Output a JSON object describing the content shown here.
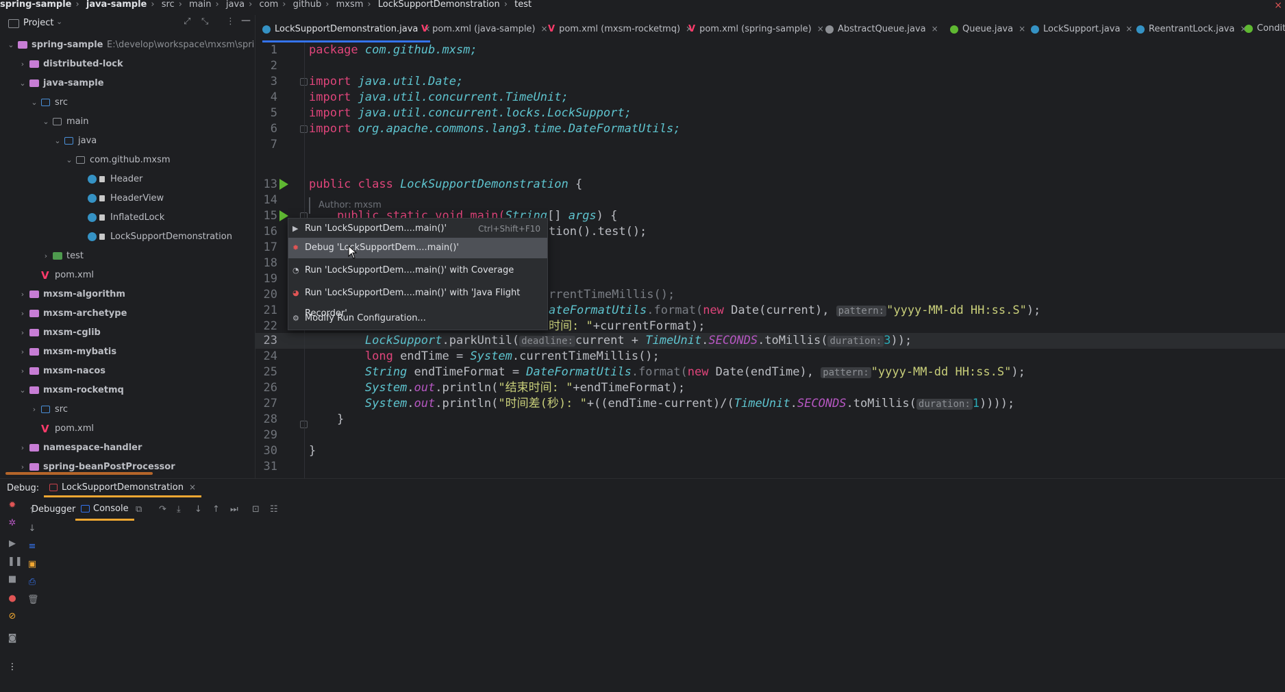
{
  "breadcrumb": [
    "spring-sample",
    "java-sample",
    "src",
    "main",
    "java",
    "com",
    "github",
    "mxsm",
    "LockSupportDemonstration",
    "test"
  ],
  "project": {
    "title": "Project",
    "tree": [
      {
        "label": "spring-sample",
        "extra": "E:\\develop\\workspace\\mxsm\\spring-sa",
        "level": 0,
        "kind": "module",
        "open": true
      },
      {
        "label": "distributed-lock",
        "level": 1,
        "kind": "module",
        "open": false
      },
      {
        "label": "java-sample",
        "level": 1,
        "kind": "module",
        "open": true
      },
      {
        "label": "src",
        "level": 2,
        "kind": "src",
        "open": true
      },
      {
        "label": "main",
        "level": 3,
        "kind": "folder",
        "open": true
      },
      {
        "label": "java",
        "level": 4,
        "kind": "src",
        "open": true
      },
      {
        "label": "com.github.mxsm",
        "level": 5,
        "kind": "folder",
        "open": true
      },
      {
        "label": "Header",
        "level": 6,
        "kind": "class"
      },
      {
        "label": "HeaderView",
        "level": 6,
        "kind": "class"
      },
      {
        "label": "InflatedLock",
        "level": 6,
        "kind": "class"
      },
      {
        "label": "LockSupportDemonstration",
        "level": 6,
        "kind": "class"
      },
      {
        "label": "test",
        "level": 3,
        "kind": "test",
        "open": false
      },
      {
        "label": "pom.xml",
        "level": 2,
        "kind": "pom"
      },
      {
        "label": "mxsm-algorithm",
        "level": 1,
        "kind": "module",
        "open": false
      },
      {
        "label": "mxsm-archetype",
        "level": 1,
        "kind": "module",
        "open": false
      },
      {
        "label": "mxsm-cglib",
        "level": 1,
        "kind": "module",
        "open": false
      },
      {
        "label": "mxsm-mybatis",
        "level": 1,
        "kind": "module",
        "open": false
      },
      {
        "label": "mxsm-nacos",
        "level": 1,
        "kind": "module",
        "open": false
      },
      {
        "label": "mxsm-rocketmq",
        "level": 1,
        "kind": "module",
        "open": true
      },
      {
        "label": "src",
        "level": 2,
        "kind": "src",
        "open": false
      },
      {
        "label": "pom.xml",
        "level": 2,
        "kind": "pom"
      },
      {
        "label": "namespace-handler",
        "level": 1,
        "kind": "module",
        "open": false
      },
      {
        "label": "spring-beanPostProcessor",
        "level": 1,
        "kind": "module",
        "open": false
      }
    ]
  },
  "tabs": [
    {
      "label": "LockSupportDemonstration.java",
      "icon": "class",
      "active": true
    },
    {
      "label": "pom.xml (java-sample)",
      "icon": "maven"
    },
    {
      "label": "pom.xml (mxsm-rocketmq)",
      "icon": "maven"
    },
    {
      "label": "pom.xml (spring-sample)",
      "icon": "maven"
    },
    {
      "label": "AbstractQueue.java",
      "icon": "abstract"
    },
    {
      "label": "Queue.java",
      "icon": "interface"
    },
    {
      "label": "LockSupport.java",
      "icon": "class"
    },
    {
      "label": "ReentrantLock.java",
      "icon": "class"
    },
    {
      "label": "Condition.ja",
      "icon": "interface"
    }
  ],
  "editor": {
    "line_numbers": [
      "1",
      "2",
      "3",
      "4",
      "5",
      "6",
      "7",
      "13",
      "14",
      "15",
      "16",
      "17",
      "18",
      "19",
      "20",
      "21",
      "22",
      "23",
      "24",
      "25",
      "26",
      "27",
      "28",
      "29",
      "30",
      "31"
    ],
    "author": "Author: mxsm",
    "code": {
      "l1_kw": "package",
      "l1_rest": " com.github.mxsm;",
      "imp": "import",
      "l3": " java.util.Date;",
      "l4": " java.util.concurrent.TimeUnit;",
      "l5": " java.util.concurrent.locks.LockSupport;",
      "l6": " org.apache.commons.lang3.time.DateFormatUtils;",
      "l13_kw": "public class",
      "l13_name": " LockSupportDemonstration",
      "l13_rest": " {",
      "l15_a": "    public static void main(",
      "l15_b": "String",
      "l15_c": "[] ",
      "l15_d": "args",
      "l15_e": ") {",
      "l16": "tion().test();",
      "l20": "rrentTimeMillis();",
      "l21_a": "ateFormatUtils",
      "l21_b": ".format(",
      "l21_c": "new",
      "l21_d": " Date(current), ",
      "hint_pattern": "pattern:",
      "fmt": "\"yyyy-MM-dd HH:ss.S\"",
      "l21_e": ");",
      "l22_a": "时间: \"",
      "l22_b": "+currentFormat);",
      "l23_a": "        LockSupport",
      "l23_b": ".parkUntil(",
      "hint_deadline": "deadline:",
      "l23_c": "current + ",
      "l23_d": "TimeUnit",
      "l23_e": ".",
      "l23_f": "SECONDS",
      "l23_g": ".toMillis(",
      "hint_duration": "duration:",
      "l23_h": "3",
      "l23_i": "));",
      "l24_a": "        long",
      "l24_b": " endTime = ",
      "l24_c": "System",
      "l24_d": ".currentTimeMillis();",
      "l25_a": "        String",
      "l25_b": " endTimeFormat = ",
      "l25_c": "DateFormatUtils",
      "l25_d": ".format(",
      "l25_e": "new",
      "l25_f": " Date(endTime), ",
      "l25_g": ");",
      "l26_a": "        System",
      "l26_b": ".",
      "l26_c": "out",
      "l26_d": ".println(",
      "l26_e": "\"结束时间: \"",
      "l26_f": "+endTimeFormat);",
      "l27_a": "        System",
      "l27_b": ".",
      "l27_c": "out",
      "l27_d": ".println(",
      "l27_e": "\"时间差(秒): \"",
      "l27_f": "+((endTime-current)/(",
      "l27_g": "TimeUnit",
      "l27_h": ".",
      "l27_i": "SECONDS",
      "l27_j": ".toMillis(",
      "l27_k": "1",
      "l27_l": "))));",
      "l28": "    }",
      "l30": "}"
    }
  },
  "context_menu": {
    "items": [
      {
        "label": "Run 'LockSupportDem....main()'",
        "shortcut": "Ctrl+Shift+F10",
        "icon": "run-icon"
      },
      {
        "label": "Debug 'LockSupportDem....main()'",
        "shortcut": "",
        "icon": "debug-icon",
        "selected": true
      },
      {
        "label": "Run 'LockSupportDem....main()' with Coverage",
        "shortcut": "",
        "icon": "coverage-icon"
      },
      {
        "label": "Run 'LockSupportDem....main()' with 'Java Flight Recorder'",
        "shortcut": "",
        "icon": "profiler-icon"
      },
      {
        "label": "Modify Run Configuration...",
        "shortcut": "",
        "icon": "gear-icon"
      }
    ]
  },
  "debug": {
    "label": "Debug:",
    "session": "LockSupportDemonstration",
    "tab_debugger": "Debugger",
    "tab_console": "Console"
  },
  "colors": {
    "accent": "#3574f0",
    "debug_tab": "#f0a732",
    "run_green": "#5fb832"
  }
}
